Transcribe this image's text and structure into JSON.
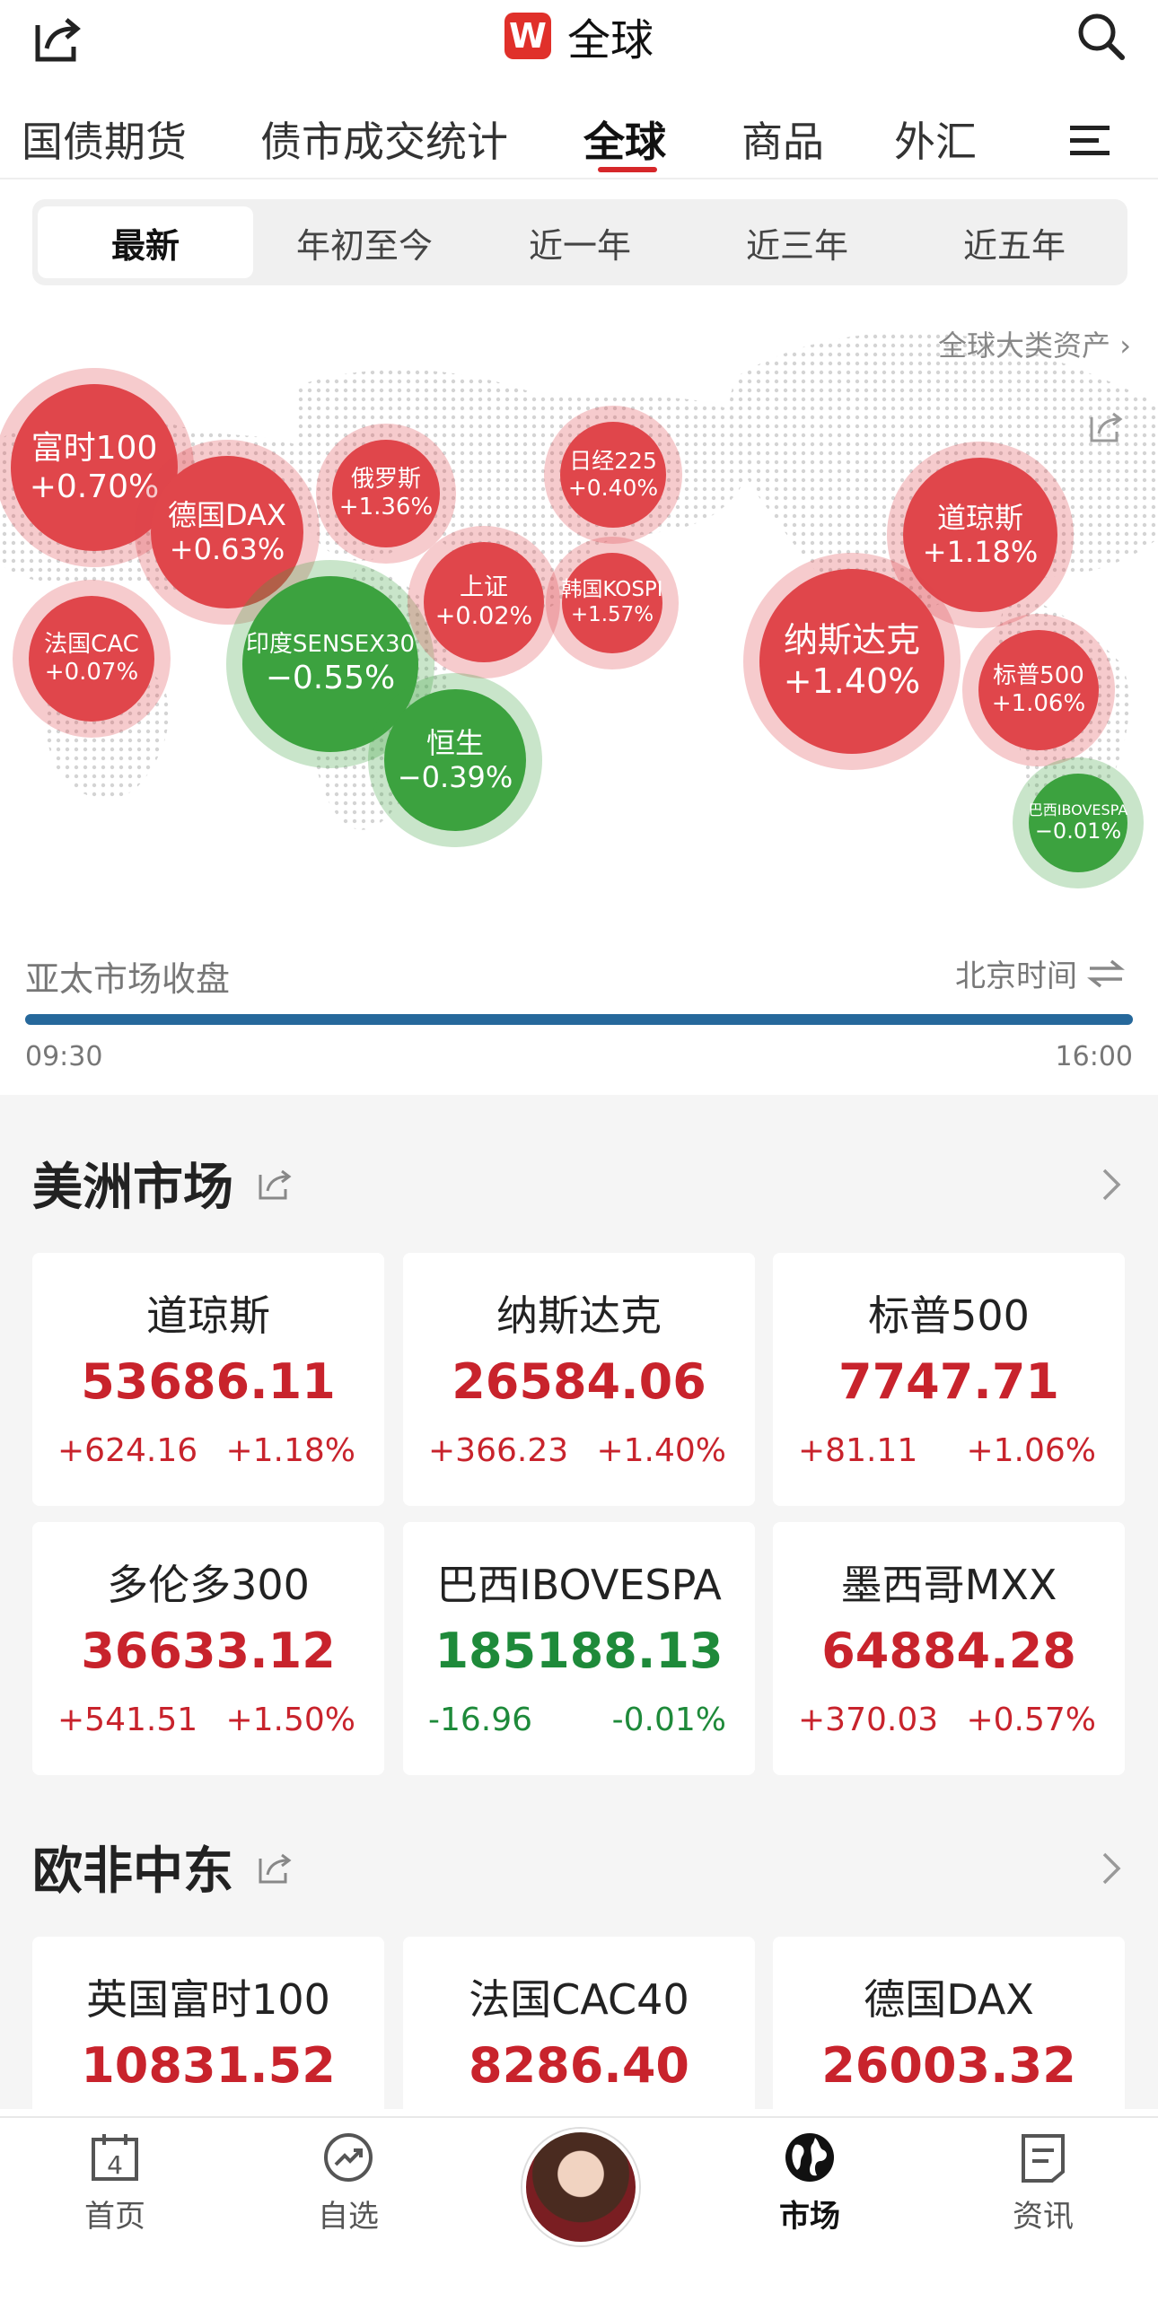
{
  "header": {
    "logo": "W",
    "title": "全球"
  },
  "tabs": [
    {
      "label": "国债期货"
    },
    {
      "label": "债市成交统计"
    },
    {
      "label": "全球"
    },
    {
      "label": "商品"
    },
    {
      "label": "外汇"
    }
  ],
  "periods": [
    "最新",
    "年初至今",
    "近一年",
    "近三年",
    "近五年"
  ],
  "global_link": "全球大类资产 ›",
  "bubbles": [
    {
      "name": "富时100",
      "change": "+0.70%",
      "dir": "up"
    },
    {
      "name": "德国DAX",
      "change": "+0.63%",
      "dir": "up"
    },
    {
      "name": "俄罗斯",
      "change": "+1.36%",
      "dir": "up"
    },
    {
      "name": "日经225",
      "change": "+0.40%",
      "dir": "up"
    },
    {
      "name": "道琼斯",
      "change": "+1.18%",
      "dir": "up"
    },
    {
      "name": "法国CAC",
      "change": "+0.07%",
      "dir": "up"
    },
    {
      "name": "印度SENSEX30",
      "change": "−0.55%",
      "dir": "down"
    },
    {
      "name": "上证",
      "change": "+0.02%",
      "dir": "up"
    },
    {
      "name": "韩国KOSPI",
      "change": "+1.57%",
      "dir": "up"
    },
    {
      "name": "纳斯达克",
      "change": "+1.40%",
      "dir": "up"
    },
    {
      "name": "标普500",
      "change": "+1.06%",
      "dir": "up"
    },
    {
      "name": "恒生",
      "change": "−0.39%",
      "dir": "down"
    },
    {
      "name": "巴西IBOVESPA",
      "change": "−0.01%",
      "dir": "down"
    }
  ],
  "session": {
    "label": "亚太市场收盘",
    "timezone": "北京时间",
    "start": "09:30",
    "end": "16:00",
    "progress": 1.0
  },
  "americas": {
    "title": "美洲市场",
    "cards": [
      {
        "name": "道琼斯",
        "value": "53686.11",
        "change": "+624.16",
        "pct": "+1.18%",
        "dir": "up"
      },
      {
        "name": "纳斯达克",
        "value": "26584.06",
        "change": "+366.23",
        "pct": "+1.40%",
        "dir": "up"
      },
      {
        "name": "标普500",
        "value": "7747.71",
        "change": "+81.11",
        "pct": "+1.06%",
        "dir": "up"
      },
      {
        "name": "多伦多300",
        "value": "36633.12",
        "change": "+541.51",
        "pct": "+1.50%",
        "dir": "up"
      },
      {
        "name": "巴西IBOVESPA",
        "value": "185188.13",
        "change": "-16.96",
        "pct": "-0.01%",
        "dir": "down"
      },
      {
        "name": "墨西哥MXX",
        "value": "64884.28",
        "change": "+370.03",
        "pct": "+0.57%",
        "dir": "up"
      }
    ]
  },
  "emea": {
    "title": "欧非中东",
    "cards": [
      {
        "name": "英国富时100",
        "value": "10831.52",
        "dir": "up"
      },
      {
        "name": "法国CAC40",
        "value": "8286.40",
        "dir": "up"
      },
      {
        "name": "德国DAX",
        "value": "26003.32",
        "dir": "up"
      }
    ]
  },
  "bottom_nav": [
    {
      "label": "首页",
      "icon": "calendar-icon"
    },
    {
      "label": "自选",
      "icon": "trend-icon"
    },
    {
      "label": "市场",
      "icon": "globe-icon"
    },
    {
      "label": "资讯",
      "icon": "news-icon"
    }
  ],
  "colors": {
    "up": "#c8232c",
    "down": "#1e8a3a",
    "accent": "#d6272a",
    "progress": "#26689b"
  }
}
